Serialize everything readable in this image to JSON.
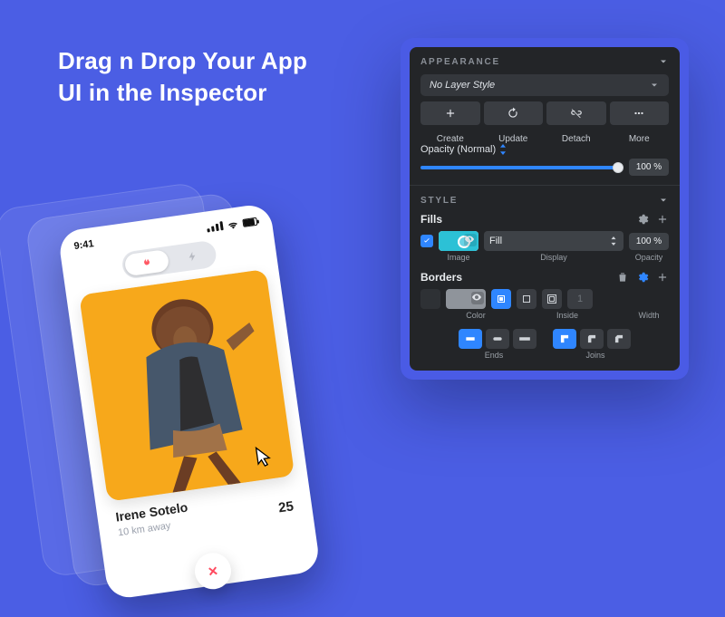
{
  "headline": "Drag n Drop Your App UI in the Inspector",
  "phone": {
    "time": "9:41",
    "card": {
      "name": "Irene Sotelo",
      "distance": "10 km away",
      "age": "25"
    },
    "toggle_icons": {
      "left": "flame-icon",
      "right": "bolt-icon"
    },
    "dislike_symbol": "×"
  },
  "inspector": {
    "sections": {
      "appearance_label": "APPEARANCE",
      "style_label": "STYLE"
    },
    "layer_style_value": "No Layer Style",
    "buttons": {
      "create": "Create",
      "update": "Update",
      "detach": "Detach",
      "more": "More"
    },
    "opacity": {
      "label": "Opacity (Normal)",
      "percent_display": "100 %"
    },
    "fills": {
      "label": "Fills",
      "swatch_caption": "Image",
      "mode_value": "Fill",
      "mode_label": "Display",
      "opacity_display": "100 %",
      "opacity_label": "Opacity",
      "enabled": true
    },
    "borders": {
      "label": "Borders",
      "color_label": "Color",
      "position_label": "Inside",
      "width_label": "Width",
      "width_value": "1"
    },
    "line": {
      "ends_label": "Ends",
      "joins_label": "Joins"
    }
  }
}
